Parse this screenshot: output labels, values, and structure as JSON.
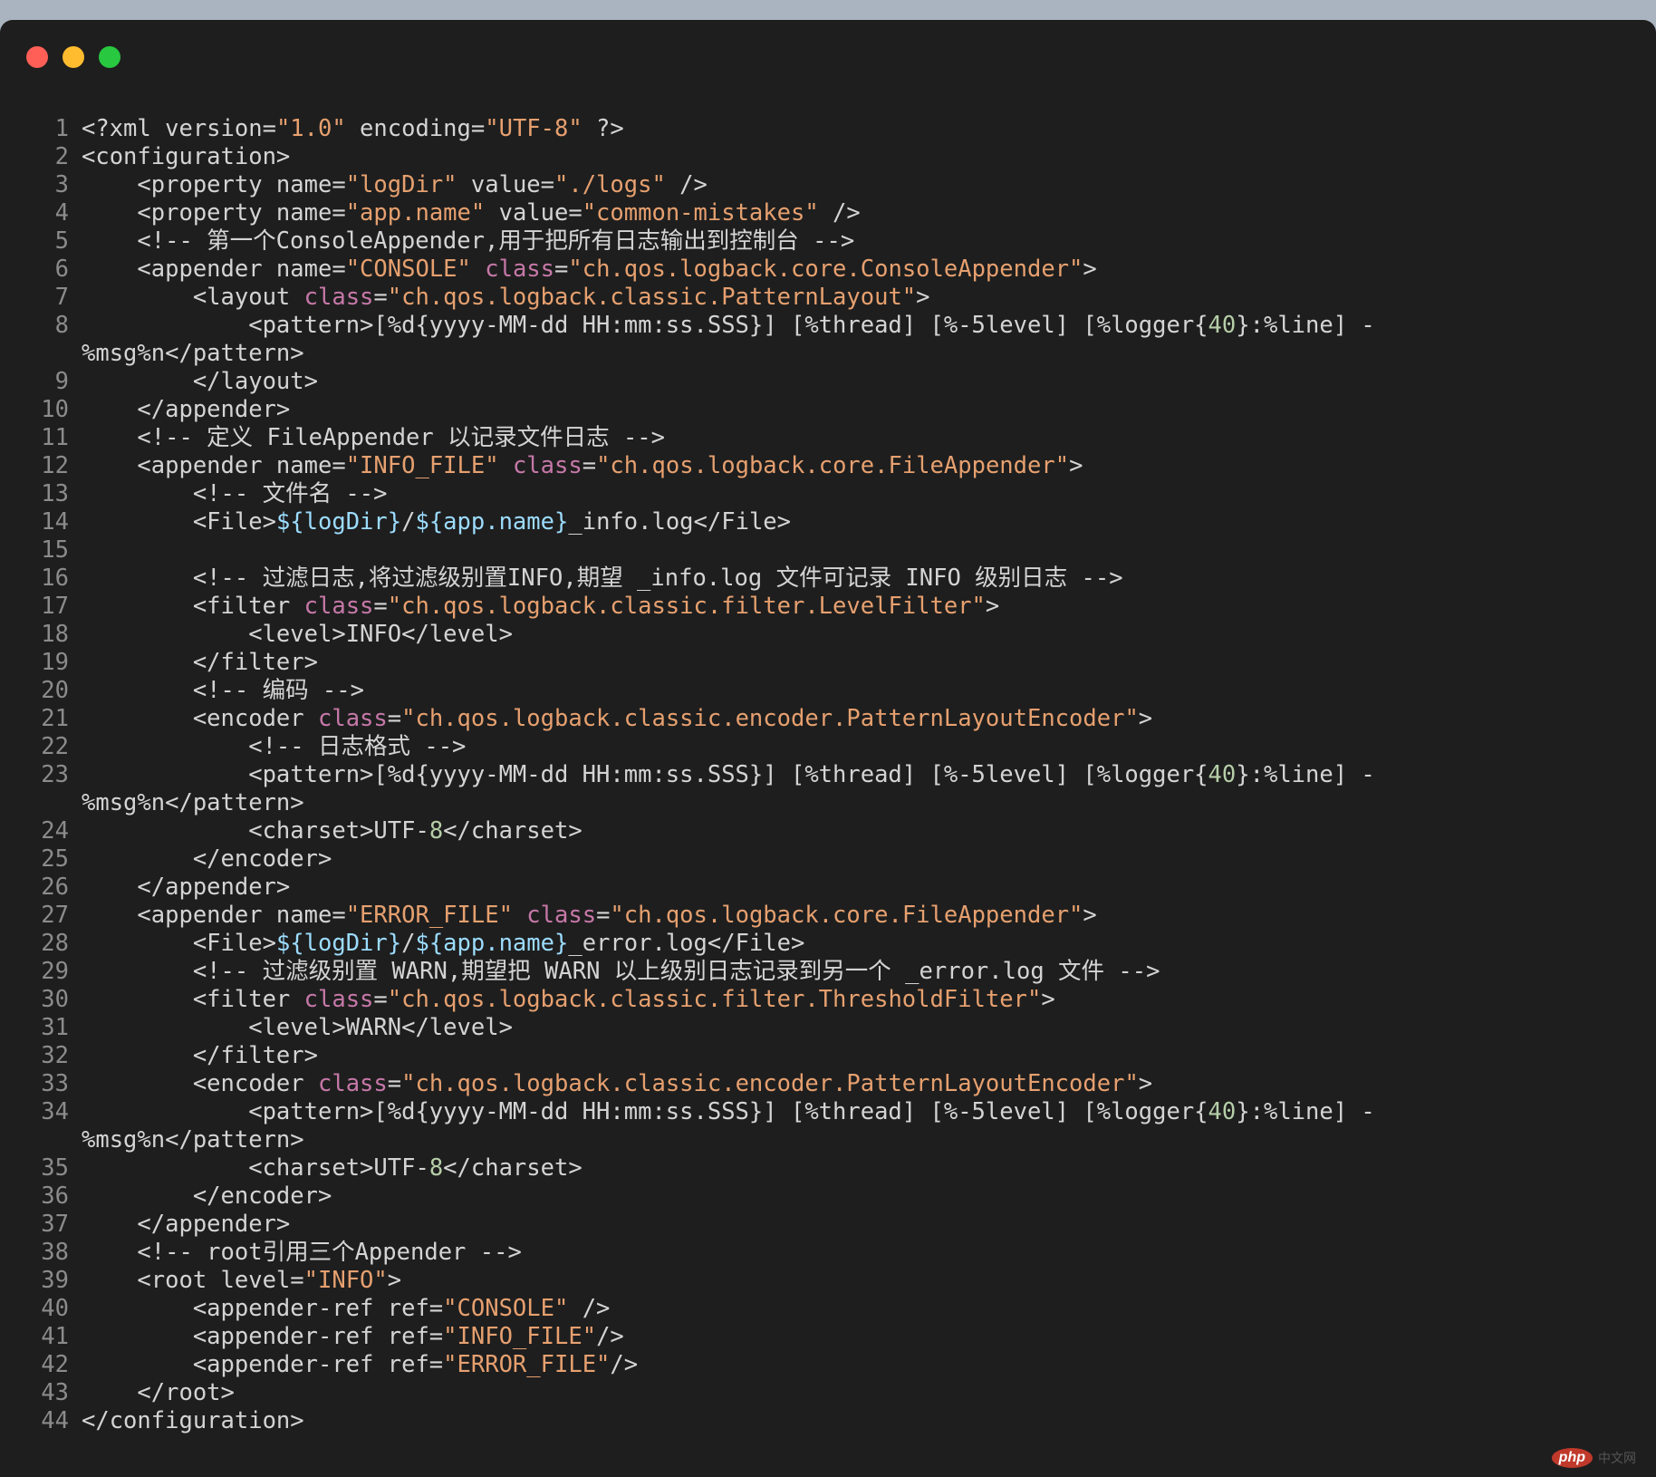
{
  "window": {
    "controls": [
      "close",
      "minimize",
      "maximize"
    ],
    "colors": {
      "close": "#ff5f57",
      "minimize": "#febc2e",
      "maximize": "#28c840",
      "background": "#1e1e1e"
    }
  },
  "code_lines": [
    {
      "n": "1",
      "t": "<?xml version=\"1.0\" encoding=\"UTF-8\" ?>"
    },
    {
      "n": "2",
      "t": "<configuration>"
    },
    {
      "n": "3",
      "t": "    <property name=\"logDir\" value=\"./logs\" />"
    },
    {
      "n": "4",
      "t": "    <property name=\"app.name\" value=\"common-mistakes\" />"
    },
    {
      "n": "5",
      "t": "    <!-- 第一个ConsoleAppender,用于把所有日志输出到控制台 -->"
    },
    {
      "n": "6",
      "t": "    <appender name=\"CONSOLE\" class=\"ch.qos.logback.core.ConsoleAppender\">"
    },
    {
      "n": "7",
      "t": "        <layout class=\"ch.qos.logback.classic.PatternLayout\">"
    },
    {
      "n": "8",
      "t": "            <pattern>[%d{yyyy-MM-dd HH:mm:ss.SSS}] [%thread] [%-5level] [%logger{40}:%line] -"
    },
    {
      "n": "",
      "t": "%msg%n</pattern>"
    },
    {
      "n": "9",
      "t": "        </layout>"
    },
    {
      "n": "10",
      "t": "    </appender>"
    },
    {
      "n": "11",
      "t": "    <!-- 定义 FileAppender 以记录文件日志 -->"
    },
    {
      "n": "12",
      "t": "    <appender name=\"INFO_FILE\" class=\"ch.qos.logback.core.FileAppender\">"
    },
    {
      "n": "13",
      "t": "        <!-- 文件名 -->"
    },
    {
      "n": "14",
      "t": "        <File>${logDir}/${app.name}_info.log</File>"
    },
    {
      "n": "15",
      "t": ""
    },
    {
      "n": "16",
      "t": "        <!-- 过滤日志,将过滤级别置INFO,期望 _info.log 文件可记录 INFO 级别日志 -->"
    },
    {
      "n": "17",
      "t": "        <filter class=\"ch.qos.logback.classic.filter.LevelFilter\">"
    },
    {
      "n": "18",
      "t": "            <level>INFO</level>"
    },
    {
      "n": "19",
      "t": "        </filter>"
    },
    {
      "n": "20",
      "t": "        <!-- 编码 -->"
    },
    {
      "n": "21",
      "t": "        <encoder class=\"ch.qos.logback.classic.encoder.PatternLayoutEncoder\">"
    },
    {
      "n": "22",
      "t": "            <!-- 日志格式 -->"
    },
    {
      "n": "23",
      "t": "            <pattern>[%d{yyyy-MM-dd HH:mm:ss.SSS}] [%thread] [%-5level] [%logger{40}:%line] -"
    },
    {
      "n": "",
      "t": "%msg%n</pattern>"
    },
    {
      "n": "24",
      "t": "            <charset>UTF-8</charset>"
    },
    {
      "n": "25",
      "t": "        </encoder>"
    },
    {
      "n": "26",
      "t": "    </appender>"
    },
    {
      "n": "27",
      "t": "    <appender name=\"ERROR_FILE\" class=\"ch.qos.logback.core.FileAppender\">"
    },
    {
      "n": "28",
      "t": "        <File>${logDir}/${app.name}_error.log</File>"
    },
    {
      "n": "29",
      "t": "        <!-- 过滤级别置 WARN,期望把 WARN 以上级别日志记录到另一个 _error.log 文件 -->"
    },
    {
      "n": "30",
      "t": "        <filter class=\"ch.qos.logback.classic.filter.ThresholdFilter\">"
    },
    {
      "n": "31",
      "t": "            <level>WARN</level>"
    },
    {
      "n": "32",
      "t": "        </filter>"
    },
    {
      "n": "33",
      "t": "        <encoder class=\"ch.qos.logback.classic.encoder.PatternLayoutEncoder\">"
    },
    {
      "n": "34",
      "t": "            <pattern>[%d{yyyy-MM-dd HH:mm:ss.SSS}] [%thread] [%-5level] [%logger{40}:%line] -"
    },
    {
      "n": "",
      "t": "%msg%n</pattern>"
    },
    {
      "n": "35",
      "t": "            <charset>UTF-8</charset>"
    },
    {
      "n": "36",
      "t": "        </encoder>"
    },
    {
      "n": "37",
      "t": "    </appender>"
    },
    {
      "n": "38",
      "t": "    <!-- root引用三个Appender -->"
    },
    {
      "n": "39",
      "t": "    <root level=\"INFO\">"
    },
    {
      "n": "40",
      "t": "        <appender-ref ref=\"CONSOLE\" />"
    },
    {
      "n": "41",
      "t": "        <appender-ref ref=\"INFO_FILE\"/>"
    },
    {
      "n": "42",
      "t": "        <appender-ref ref=\"ERROR_FILE\"/>"
    },
    {
      "n": "43",
      "t": "    </root>"
    },
    {
      "n": "44",
      "t": "</configuration>"
    }
  ],
  "watermark": {
    "logo": "php",
    "text": "中文网"
  }
}
